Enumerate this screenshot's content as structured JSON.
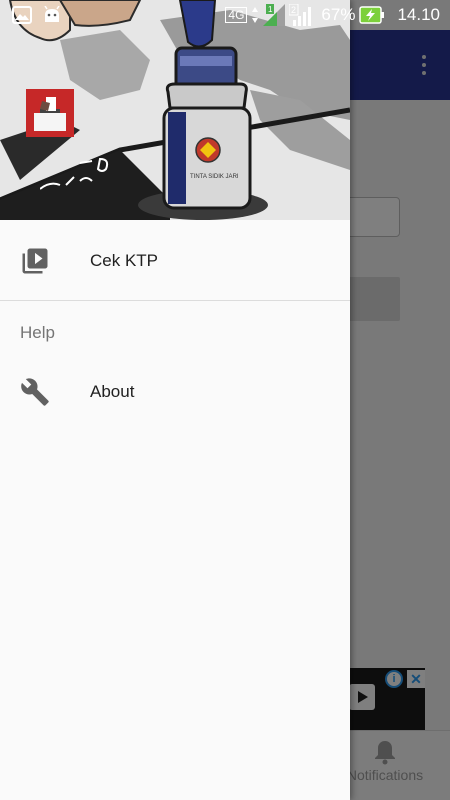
{
  "status_bar": {
    "network_type": "4G",
    "sim_slot": "2",
    "battery_percent": "67%",
    "time": "14.10"
  },
  "drawer": {
    "items": [
      {
        "label": "Cek KTP",
        "icon": "video-library-icon"
      },
      {
        "label": "About",
        "icon": "wrench-icon"
      }
    ],
    "sections": {
      "help": "Help"
    }
  },
  "background_app": {
    "bottom_tab_label": "Notifications",
    "ad": {
      "info": "i",
      "close": "✕"
    }
  },
  "colors": {
    "toolbar": "#283593",
    "battery_charging": "#7cd03b",
    "signal_active": "#4caf50"
  }
}
